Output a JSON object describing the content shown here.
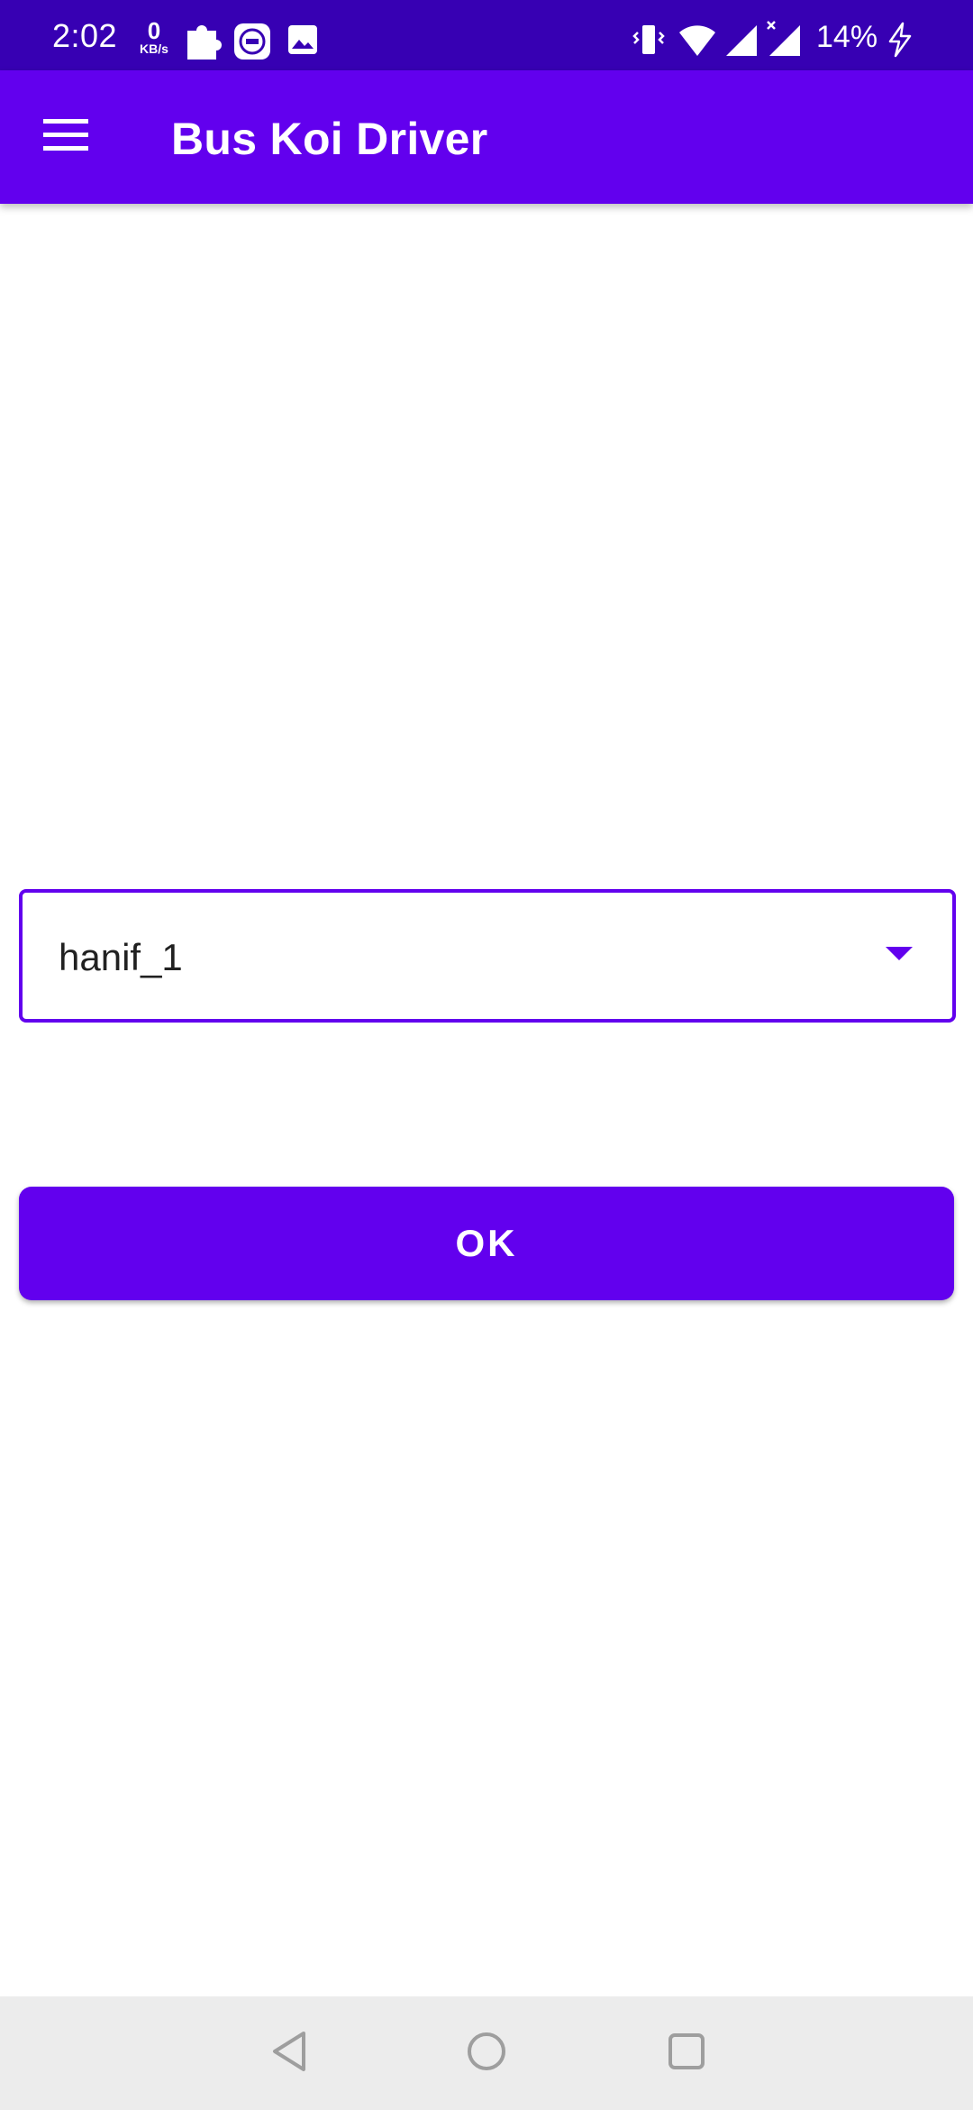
{
  "status_bar": {
    "time": "2:02",
    "net_speed_value": "0",
    "net_speed_unit": "KB/s",
    "battery": "14%"
  },
  "app_bar": {
    "title": "Bus Koi Driver"
  },
  "form": {
    "dropdown_value": "hanif_1",
    "ok_label": "OK"
  },
  "colors": {
    "status_bar": "#3700B3",
    "primary": "#6200EE",
    "nav_bar": "#ECECEC"
  },
  "icons": {
    "menu": "menu-icon",
    "dropdown": "arrow-drop-down-icon",
    "back": "back-triangle-icon",
    "home": "home-circle-icon",
    "recents": "recents-square-icon"
  }
}
